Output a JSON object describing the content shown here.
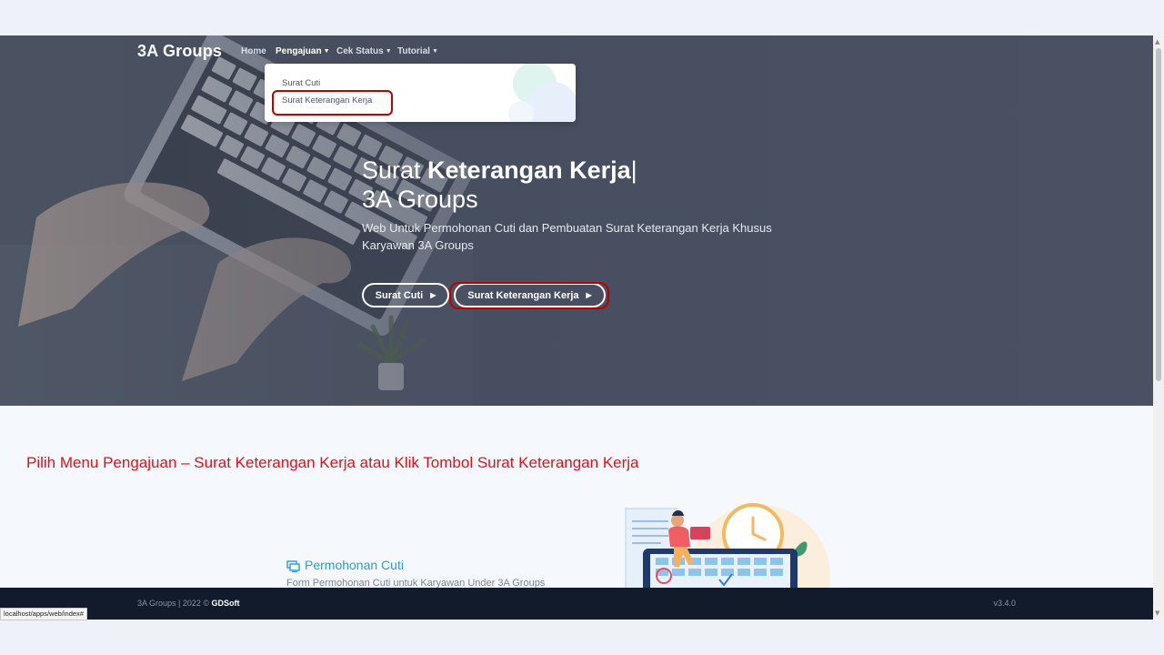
{
  "navbar": {
    "brand": "3A Groups",
    "items": [
      {
        "label": "Home"
      },
      {
        "label": "Pengajuan"
      },
      {
        "label": "Cek Status"
      },
      {
        "label": "Tutorial"
      }
    ],
    "dropdown": {
      "items": [
        {
          "label": "Surat Cuti"
        },
        {
          "label": "Surat Keterangan Kerja"
        }
      ]
    }
  },
  "hero": {
    "title_prefix": "Surat ",
    "title_bold": "Keterangan Kerja",
    "title_cursor": "|",
    "title_line2": "3A Groups",
    "subtitle": "Web Untuk Permohonan Cuti dan Pembuatan Surat Keterangan Kerja Khusus Karyawan 3A Groups",
    "buttons": [
      {
        "label": "Surat Cuti",
        "icon": "play-arrow-icon"
      },
      {
        "label": "Surat Keterangan Kerja",
        "icon": "play-arrow-icon"
      }
    ]
  },
  "instruction": "Pilih  Menu Pengajuan – Surat Keterangan Kerja atau Klik  Tombol Surat Keterangan Kerja",
  "services": {
    "title": "Permohonan Cuti",
    "description": "Form Permohonan Cuti untuk Karyawan Under 3A Groups",
    "icon": "desktop-icon"
  },
  "footer": {
    "left_prefix": "3A Groups | 2022 © ",
    "left_brand": "GDSoft",
    "version": "v3.4.0"
  },
  "status_bar": {
    "url": "localhost/apps/web/index#"
  },
  "colors": {
    "highlight": "#c00000",
    "instruction": "#e0101a",
    "service_title": "#2b9bd6",
    "footer_bg": "#121b2c"
  }
}
